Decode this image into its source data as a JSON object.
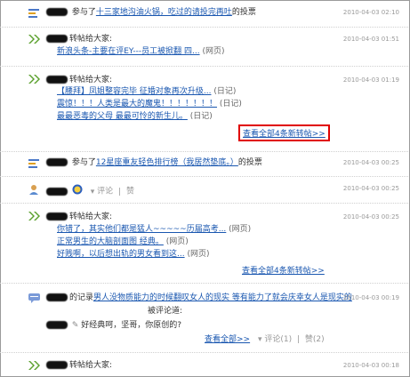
{
  "items": [
    {
      "action": "参与了",
      "link": "十三家地沟油火锅，吃过的请投完再吐",
      "tail": "的投票",
      "time": "2010-04-03 02:10"
    },
    {
      "action": "转帖给大家:",
      "links": [
        {
          "text": "新浪头条-主要在评EY---员工被掀翻 四...",
          "type": "(网页)"
        }
      ],
      "time": "2010-04-03 01:51"
    },
    {
      "action": "转帖给大家:",
      "links": [
        {
          "text": "【腰拜】凤姐整容完毕 征婚对象再次升级...",
          "type": "(日记)"
        },
        {
          "text": "震惊！！！人类是最大的魔鬼！！！！！！！",
          "type": "(日记)"
        },
        {
          "text": "最最恶毒的父母 最最可怜的新生儿。",
          "type": "(日记)"
        }
      ],
      "more": "查看全部4条新转帖>>",
      "time": "2010-04-03 01:19"
    },
    {
      "action": "参与了",
      "link": "12星座重友轻色排行榜（我居然垫底。）",
      "tail": "的投票",
      "time": "2010-04-03 00:25"
    },
    {
      "comment": "评论",
      "like": "赞",
      "time": "2010-04-03 00:25"
    },
    {
      "action": "转帖给大家:",
      "links": [
        {
          "text": "你错了，其实他们都是猛人~~~~~历届高考...",
          "type": "(网页)"
        },
        {
          "text": "正常男生的大脑剖面图  经典。",
          "type": "(网页)"
        },
        {
          "text": "好贱啊，以后想出轨的男女看到这...",
          "type": "(网页)"
        }
      ],
      "more": "查看全部4条新转帖>>",
      "time": "2010-04-03 00:25"
    },
    {
      "prefix": "的记录",
      "record_link": "男人没物质能力的时候翻叹女人的现实 等有能力了就会庆幸女人是现实的",
      "suffix": "被评论道:",
      "quote": "好经典呵，坚哥，你原创的?",
      "more": "查看全部>>",
      "comment": "评论(1)",
      "like": "赞(2)",
      "time": "2010-04-03 00:19"
    },
    {
      "action": "转帖给大家:",
      "time": "2010-04-03 00:18"
    }
  ],
  "colors": {
    "link": "#1a57b0",
    "highlight_box": "#e00000",
    "timestamp": "#999999",
    "arrow_green": "#5aa02c"
  }
}
